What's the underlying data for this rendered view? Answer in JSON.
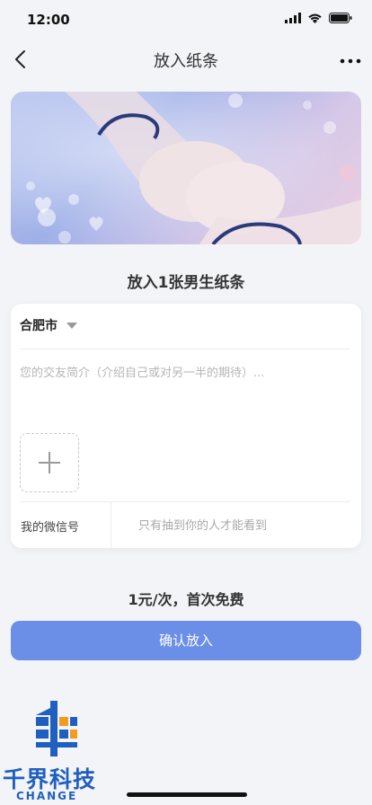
{
  "status_bar": {
    "time": "12:00"
  },
  "nav": {
    "title": "放入纸条"
  },
  "section_title": "放入1张男生纸条",
  "form": {
    "city": "合肥市",
    "intro_placeholder": "您的交友简介（介绍自己或对另一半的期待）...",
    "wechat_label": "我的微信号",
    "wechat_placeholder": "只有抽到你的人才能看到"
  },
  "price_text": "1元/次，首次免费",
  "confirm_label": "确认放入",
  "logo": {
    "name": "千界科技",
    "sub": "CHANGE"
  },
  "colors": {
    "accent": "#6b8ee6",
    "background": "#f3f4f7",
    "logo_blue": "#1f5fbf"
  }
}
